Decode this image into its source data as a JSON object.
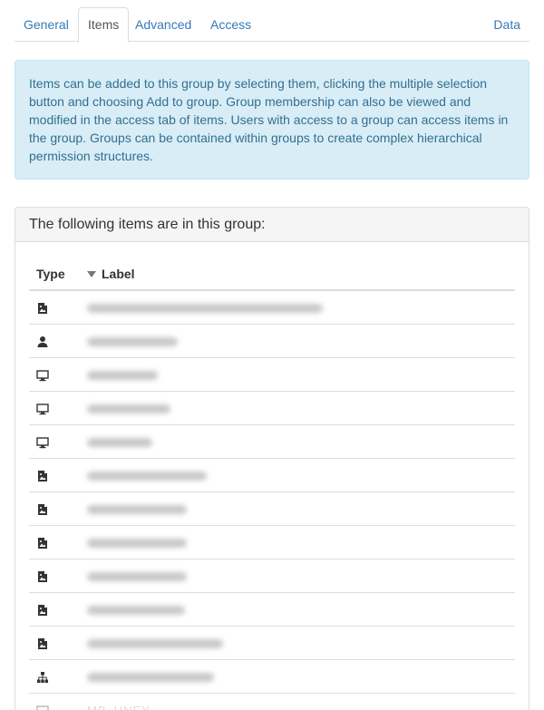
{
  "tabs": {
    "general": "General",
    "items": "Items",
    "advanced": "Advanced",
    "access": "Access",
    "data": "Data"
  },
  "info": {
    "text": "Items can be added to this group by selecting them, clicking the multiple selection button and choosing Add to group. Group membership can also be viewed and modified in the access tab of items. Users with access to a group can access items in the group. Groups can be contained within groups to create complex hierarchical permission structures."
  },
  "panel": {
    "heading": "The following items are in this group:",
    "columns": {
      "type": "Type",
      "label": "Label"
    },
    "sort": "label-descending",
    "rows": [
      {
        "icon": "image-icon"
      },
      {
        "icon": "user-icon"
      },
      {
        "icon": "monitor-icon"
      },
      {
        "icon": "monitor-icon"
      },
      {
        "icon": "monitor-icon"
      },
      {
        "icon": "image-icon"
      },
      {
        "icon": "image-icon"
      },
      {
        "icon": "image-icon"
      },
      {
        "icon": "image-icon"
      },
      {
        "icon": "image-icon"
      },
      {
        "icon": "image-icon"
      },
      {
        "icon": "hierarchy-icon"
      }
    ],
    "partial_row": {
      "icon": "monitor-icon",
      "label": "MB_UNEY"
    }
  },
  "colors": {
    "link": "#337ab7",
    "info_bg": "#d9edf7",
    "info_border": "#bce8f1",
    "info_text": "#31708f"
  }
}
